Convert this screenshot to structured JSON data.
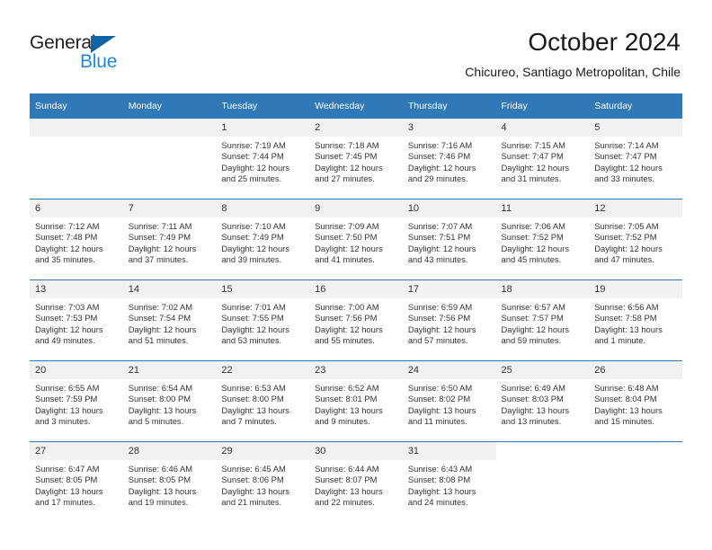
{
  "brand": {
    "name_part1": "General",
    "name_part2": "Blue",
    "accent_color": "#2288dd",
    "logo_triangle_color": "#0f64a8"
  },
  "header": {
    "title": "October 2024",
    "subtitle": "Chicureo, Santiago Metropolitan, Chile"
  },
  "theme": {
    "header_bar_color": "#3079b9",
    "daynum_band_color": "#f1f1f1",
    "text_color": "#333333"
  },
  "weekdays": [
    "Sunday",
    "Monday",
    "Tuesday",
    "Wednesday",
    "Thursday",
    "Friday",
    "Saturday"
  ],
  "weeks": [
    [
      {
        "day": "",
        "sunrise": "",
        "sunset": "",
        "daylight_line1": "",
        "daylight_line2": "",
        "empty": true
      },
      {
        "day": "",
        "sunrise": "",
        "sunset": "",
        "daylight_line1": "",
        "daylight_line2": "",
        "empty": true
      },
      {
        "day": "1",
        "sunrise": "Sunrise: 7:19 AM",
        "sunset": "Sunset: 7:44 PM",
        "daylight_line1": "Daylight: 12 hours",
        "daylight_line2": "and 25 minutes."
      },
      {
        "day": "2",
        "sunrise": "Sunrise: 7:18 AM",
        "sunset": "Sunset: 7:45 PM",
        "daylight_line1": "Daylight: 12 hours",
        "daylight_line2": "and 27 minutes."
      },
      {
        "day": "3",
        "sunrise": "Sunrise: 7:16 AM",
        "sunset": "Sunset: 7:46 PM",
        "daylight_line1": "Daylight: 12 hours",
        "daylight_line2": "and 29 minutes."
      },
      {
        "day": "4",
        "sunrise": "Sunrise: 7:15 AM",
        "sunset": "Sunset: 7:47 PM",
        "daylight_line1": "Daylight: 12 hours",
        "daylight_line2": "and 31 minutes."
      },
      {
        "day": "5",
        "sunrise": "Sunrise: 7:14 AM",
        "sunset": "Sunset: 7:47 PM",
        "daylight_line1": "Daylight: 12 hours",
        "daylight_line2": "and 33 minutes."
      }
    ],
    [
      {
        "day": "6",
        "sunrise": "Sunrise: 7:12 AM",
        "sunset": "Sunset: 7:48 PM",
        "daylight_line1": "Daylight: 12 hours",
        "daylight_line2": "and 35 minutes."
      },
      {
        "day": "7",
        "sunrise": "Sunrise: 7:11 AM",
        "sunset": "Sunset: 7:49 PM",
        "daylight_line1": "Daylight: 12 hours",
        "daylight_line2": "and 37 minutes."
      },
      {
        "day": "8",
        "sunrise": "Sunrise: 7:10 AM",
        "sunset": "Sunset: 7:49 PM",
        "daylight_line1": "Daylight: 12 hours",
        "daylight_line2": "and 39 minutes."
      },
      {
        "day": "9",
        "sunrise": "Sunrise: 7:09 AM",
        "sunset": "Sunset: 7:50 PM",
        "daylight_line1": "Daylight: 12 hours",
        "daylight_line2": "and 41 minutes."
      },
      {
        "day": "10",
        "sunrise": "Sunrise: 7:07 AM",
        "sunset": "Sunset: 7:51 PM",
        "daylight_line1": "Daylight: 12 hours",
        "daylight_line2": "and 43 minutes."
      },
      {
        "day": "11",
        "sunrise": "Sunrise: 7:06 AM",
        "sunset": "Sunset: 7:52 PM",
        "daylight_line1": "Daylight: 12 hours",
        "daylight_line2": "and 45 minutes."
      },
      {
        "day": "12",
        "sunrise": "Sunrise: 7:05 AM",
        "sunset": "Sunset: 7:52 PM",
        "daylight_line1": "Daylight: 12 hours",
        "daylight_line2": "and 47 minutes."
      }
    ],
    [
      {
        "day": "13",
        "sunrise": "Sunrise: 7:03 AM",
        "sunset": "Sunset: 7:53 PM",
        "daylight_line1": "Daylight: 12 hours",
        "daylight_line2": "and 49 minutes."
      },
      {
        "day": "14",
        "sunrise": "Sunrise: 7:02 AM",
        "sunset": "Sunset: 7:54 PM",
        "daylight_line1": "Daylight: 12 hours",
        "daylight_line2": "and 51 minutes."
      },
      {
        "day": "15",
        "sunrise": "Sunrise: 7:01 AM",
        "sunset": "Sunset: 7:55 PM",
        "daylight_line1": "Daylight: 12 hours",
        "daylight_line2": "and 53 minutes."
      },
      {
        "day": "16",
        "sunrise": "Sunrise: 7:00 AM",
        "sunset": "Sunset: 7:56 PM",
        "daylight_line1": "Daylight: 12 hours",
        "daylight_line2": "and 55 minutes."
      },
      {
        "day": "17",
        "sunrise": "Sunrise: 6:59 AM",
        "sunset": "Sunset: 7:56 PM",
        "daylight_line1": "Daylight: 12 hours",
        "daylight_line2": "and 57 minutes."
      },
      {
        "day": "18",
        "sunrise": "Sunrise: 6:57 AM",
        "sunset": "Sunset: 7:57 PM",
        "daylight_line1": "Daylight: 12 hours",
        "daylight_line2": "and 59 minutes."
      },
      {
        "day": "19",
        "sunrise": "Sunrise: 6:56 AM",
        "sunset": "Sunset: 7:58 PM",
        "daylight_line1": "Daylight: 13 hours",
        "daylight_line2": "and 1 minute."
      }
    ],
    [
      {
        "day": "20",
        "sunrise": "Sunrise: 6:55 AM",
        "sunset": "Sunset: 7:59 PM",
        "daylight_line1": "Daylight: 13 hours",
        "daylight_line2": "and 3 minutes."
      },
      {
        "day": "21",
        "sunrise": "Sunrise: 6:54 AM",
        "sunset": "Sunset: 8:00 PM",
        "daylight_line1": "Daylight: 13 hours",
        "daylight_line2": "and 5 minutes."
      },
      {
        "day": "22",
        "sunrise": "Sunrise: 6:53 AM",
        "sunset": "Sunset: 8:00 PM",
        "daylight_line1": "Daylight: 13 hours",
        "daylight_line2": "and 7 minutes."
      },
      {
        "day": "23",
        "sunrise": "Sunrise: 6:52 AM",
        "sunset": "Sunset: 8:01 PM",
        "daylight_line1": "Daylight: 13 hours",
        "daylight_line2": "and 9 minutes."
      },
      {
        "day": "24",
        "sunrise": "Sunrise: 6:50 AM",
        "sunset": "Sunset: 8:02 PM",
        "daylight_line1": "Daylight: 13 hours",
        "daylight_line2": "and 11 minutes."
      },
      {
        "day": "25",
        "sunrise": "Sunrise: 6:49 AM",
        "sunset": "Sunset: 8:03 PM",
        "daylight_line1": "Daylight: 13 hours",
        "daylight_line2": "and 13 minutes."
      },
      {
        "day": "26",
        "sunrise": "Sunrise: 6:48 AM",
        "sunset": "Sunset: 8:04 PM",
        "daylight_line1": "Daylight: 13 hours",
        "daylight_line2": "and 15 minutes."
      }
    ],
    [
      {
        "day": "27",
        "sunrise": "Sunrise: 6:47 AM",
        "sunset": "Sunset: 8:05 PM",
        "daylight_line1": "Daylight: 13 hours",
        "daylight_line2": "and 17 minutes."
      },
      {
        "day": "28",
        "sunrise": "Sunrise: 6:46 AM",
        "sunset": "Sunset: 8:05 PM",
        "daylight_line1": "Daylight: 13 hours",
        "daylight_line2": "and 19 minutes."
      },
      {
        "day": "29",
        "sunrise": "Sunrise: 6:45 AM",
        "sunset": "Sunset: 8:06 PM",
        "daylight_line1": "Daylight: 13 hours",
        "daylight_line2": "and 21 minutes."
      },
      {
        "day": "30",
        "sunrise": "Sunrise: 6:44 AM",
        "sunset": "Sunset: 8:07 PM",
        "daylight_line1": "Daylight: 13 hours",
        "daylight_line2": "and 22 minutes."
      },
      {
        "day": "31",
        "sunrise": "Sunrise: 6:43 AM",
        "sunset": "Sunset: 8:08 PM",
        "daylight_line1": "Daylight: 13 hours",
        "daylight_line2": "and 24 minutes."
      },
      {
        "day": "",
        "sunrise": "",
        "sunset": "",
        "daylight_line1": "",
        "daylight_line2": "",
        "blank": true
      },
      {
        "day": "",
        "sunrise": "",
        "sunset": "",
        "daylight_line1": "",
        "daylight_line2": "",
        "blank": true
      }
    ]
  ]
}
